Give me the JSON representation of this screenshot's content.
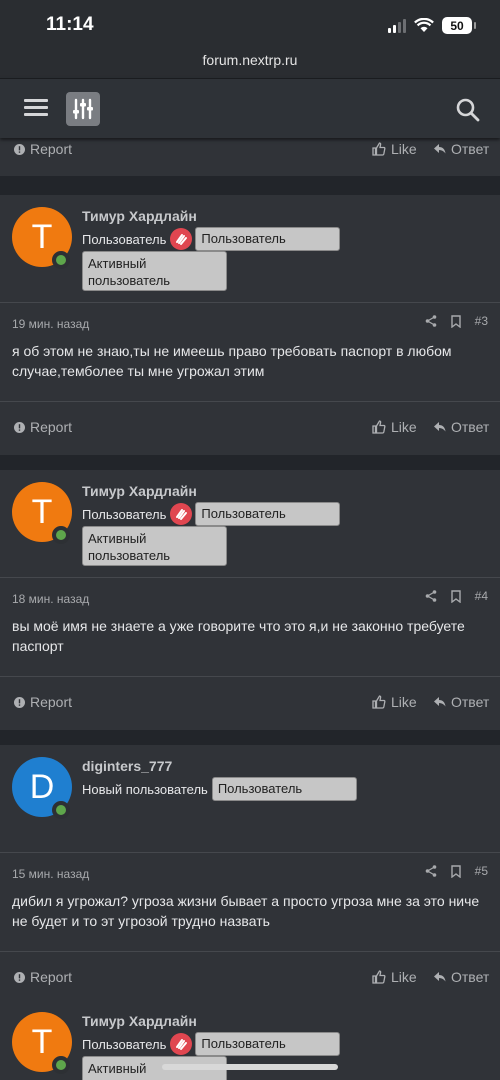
{
  "status": {
    "time": "11:14",
    "battery": "50"
  },
  "browser": {
    "url": "forum.nextrp.ru"
  },
  "labels": {
    "report": "Report",
    "like": "Like",
    "reply": "Ответ"
  },
  "posts": [
    {
      "author": "Тимур Хардлайн",
      "avatar_letter": "T",
      "avatar_color": "#f07a10",
      "role": "Пользователь",
      "banner": "Пользователь",
      "banner2": "Активный пользователь",
      "time": "19 мин. назад",
      "number": "#3",
      "text": "я об этом не знаю,ты не имеешь право требовать паспорт в любом случае,темболее ты мне угрожал этим"
    },
    {
      "author": "Тимур Хардлайн",
      "avatar_letter": "T",
      "avatar_color": "#f07a10",
      "role": "Пользователь",
      "banner": "Пользователь",
      "banner2": "Активный пользователь",
      "time": "18 мин. назад",
      "number": "#4",
      "text": "вы моё имя не знаете а уже говорите что это я,и не законно требуете паспорт"
    },
    {
      "author": "diginters_777",
      "avatar_letter": "D",
      "avatar_color": "#1f7fd0",
      "role": "Новый пользователь",
      "banner": "Пользователь",
      "time": "15 мин. назад",
      "number": "#5",
      "text": "дибил я угрожал? угроза жизни бывает а просто угроза мне за это ниче не будет и то эт угрозой трудно назвать"
    },
    {
      "author": "Тимур Хардлайн",
      "avatar_letter": "T",
      "avatar_color": "#f07a10",
      "role": "Пользователь",
      "banner": "Пользователь",
      "banner2": "Активный"
    }
  ]
}
